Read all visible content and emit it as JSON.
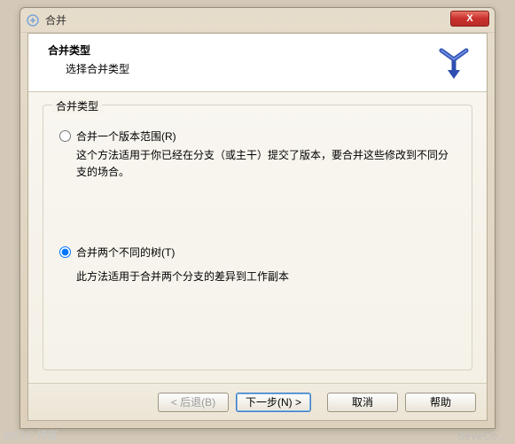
{
  "window": {
    "title": "合并",
    "close_glyph": "X"
  },
  "header": {
    "title": "合并类型",
    "subtitle": "选择合并类型"
  },
  "group": {
    "legend": "合并类型",
    "option1": {
      "label": "合并一个版本范围(R)",
      "desc": "这个方法适用于你已经在分支（或主干）提交了版本，要合并这些修改到不同分支的场合。",
      "checked": false
    },
    "option2": {
      "label": "合并两个不同的树(T)",
      "desc": "此方法适用于合并两个分支的差异到工作副本",
      "checked": true
    }
  },
  "buttons": {
    "back": "< 后退(B)",
    "next": "下一步(N) >",
    "cancel": "取消",
    "help": "帮助"
  },
  "watermark": {
    "right": "SeveCo...",
    "left": "@51C 博客"
  }
}
